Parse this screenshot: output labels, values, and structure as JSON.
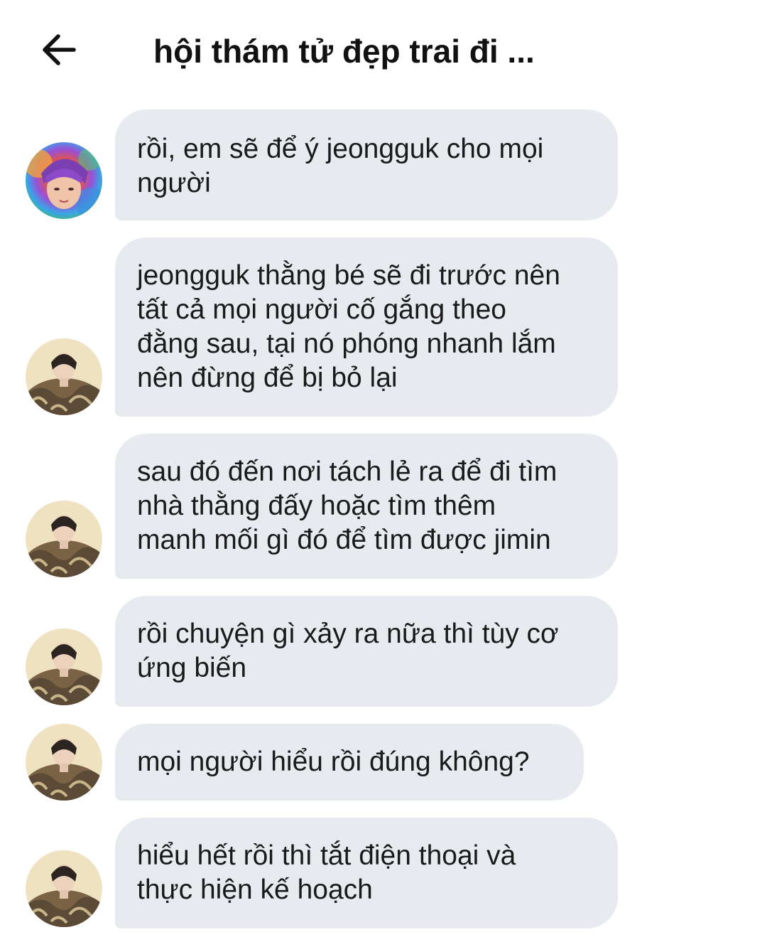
{
  "header": {
    "back_icon": "arrow-left-icon",
    "title": "hội thám tử đẹp trai đi ..."
  },
  "colors": {
    "bubble": "#e7ebf0",
    "text": "#1a1a1a",
    "background": "#ffffff"
  },
  "messages": [
    {
      "text": "rồi, em sẽ để ý jeongguk cho mọi\nngười",
      "avatar": "rainbow-avatar"
    },
    {
      "text": "jeongguk thằng bé sẽ đi trước nên\ntất cả mọi người cố gắng theo\nđằng sau, tại nó phóng nhanh lắm\nnên đừng để bị bỏ lại",
      "avatar": "fur-coat-avatar"
    },
    {
      "text": "sau đó đến nơi tách lẻ ra để đi tìm\nnhà thằng đấy hoặc tìm thêm\nmanh mối gì đó để tìm được jimin",
      "avatar": "fur-coat-avatar"
    },
    {
      "text": "rồi chuyện gì xảy ra nữa thì tùy cơ\nứng biến",
      "avatar": "fur-coat-avatar"
    },
    {
      "text": "mọi người hiểu rồi đúng không?",
      "avatar": "fur-coat-avatar"
    },
    {
      "text": "hiểu hết rồi thì tắt điện thoại và\nthực hiện kế hoạch",
      "avatar": "fur-coat-avatar"
    }
  ]
}
